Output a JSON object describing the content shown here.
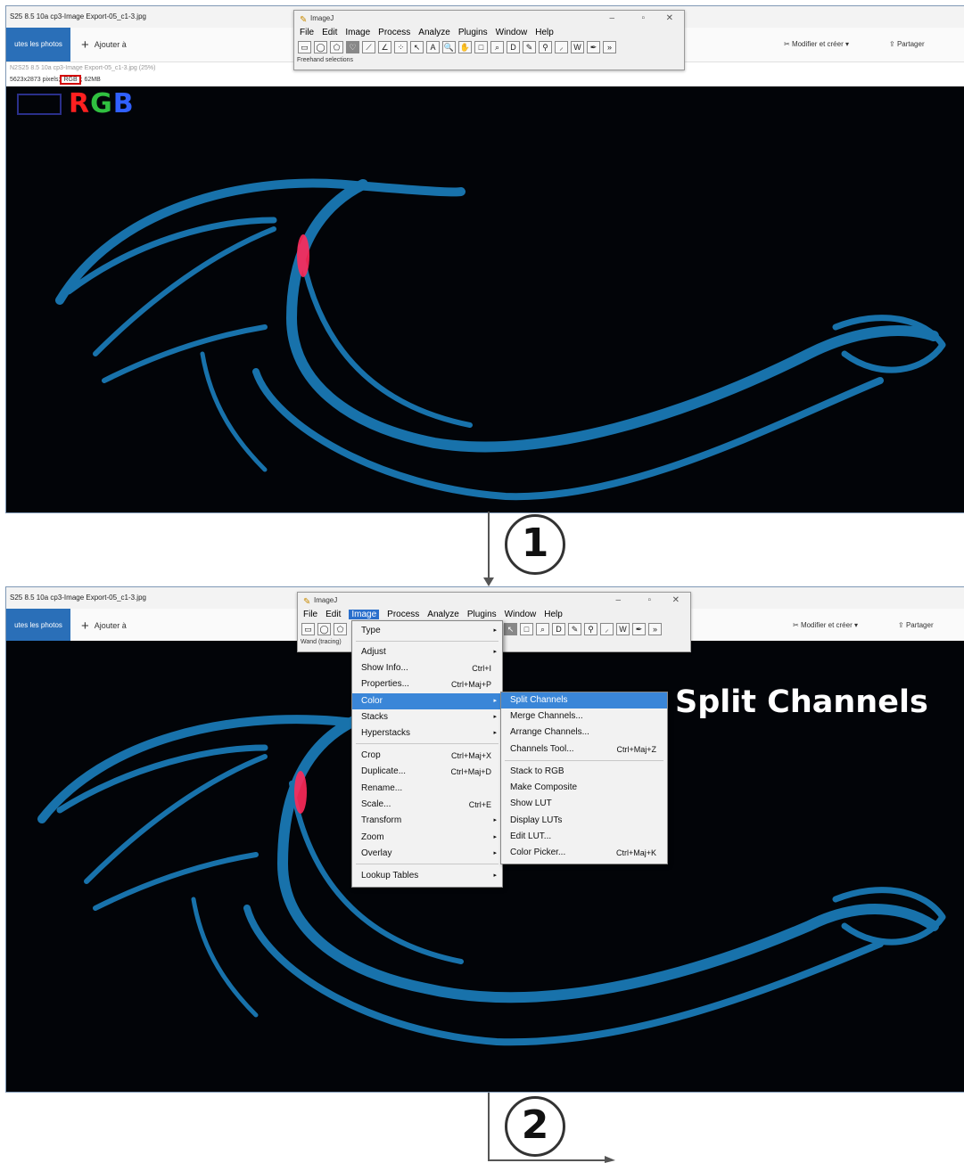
{
  "panel1": {
    "title": "S25 8.5 10a cp3-Image Export-05_c1-3.jpg",
    "photos_tab": "utes les photos",
    "add_label": "Ajouter à",
    "edit_create_label": "Modifier et créer",
    "share_label": "Partager",
    "subtitle": "N2S25 8.5 10a cp3-Image Export-05_c1-3.jpg (25%)",
    "info_prefix": "5623x2873 pixels;",
    "info_rgb": "RGB",
    "info_suffix": "; 62MB",
    "overlay_label": "RGB"
  },
  "imagej1": {
    "title": "ImageJ",
    "menus": [
      "File",
      "Edit",
      "Image",
      "Process",
      "Analyze",
      "Plugins",
      "Window",
      "Help"
    ],
    "status": "Freehand selections"
  },
  "panel2": {
    "title": "S25 8.5 10a cp3-Image Export-05_c1-3.jpg",
    "photos_tab": "utes les photos",
    "add_label": "Ajouter à",
    "edit_create_label": "Modifier et créer",
    "share_label": "Partager"
  },
  "imagej2": {
    "title": "ImageJ",
    "menus": [
      "File",
      "Edit",
      "Image",
      "Process",
      "Analyze",
      "Plugins",
      "Window",
      "Help"
    ],
    "status": "Wand (tracing)"
  },
  "image_menu": [
    {
      "label": "Type",
      "shortcut": "",
      "submenu": true
    },
    {
      "label": "Adjust",
      "shortcut": "",
      "submenu": true
    },
    {
      "label": "Show Info...",
      "shortcut": "Ctrl+I",
      "submenu": false
    },
    {
      "label": "Properties...",
      "shortcut": "Ctrl+Maj+P",
      "submenu": false
    },
    {
      "label": "Color",
      "shortcut": "",
      "submenu": true,
      "selected": true
    },
    {
      "label": "Stacks",
      "shortcut": "",
      "submenu": true
    },
    {
      "label": "Hyperstacks",
      "shortcut": "",
      "submenu": true
    },
    {
      "label": "Crop",
      "shortcut": "Ctrl+Maj+X",
      "submenu": false
    },
    {
      "label": "Duplicate...",
      "shortcut": "Ctrl+Maj+D",
      "submenu": false
    },
    {
      "label": "Rename...",
      "shortcut": "",
      "submenu": false
    },
    {
      "label": "Scale...",
      "shortcut": "Ctrl+E",
      "submenu": false
    },
    {
      "label": "Transform",
      "shortcut": "",
      "submenu": true
    },
    {
      "label": "Zoom",
      "shortcut": "",
      "submenu": true
    },
    {
      "label": "Overlay",
      "shortcut": "",
      "submenu": true
    },
    {
      "label": "Lookup Tables",
      "shortcut": "",
      "submenu": true
    }
  ],
  "color_submenu": [
    {
      "label": "Split Channels",
      "shortcut": "",
      "selected": true
    },
    {
      "label": "Merge Channels...",
      "shortcut": ""
    },
    {
      "label": "Arrange Channels...",
      "shortcut": ""
    },
    {
      "label": "Channels Tool...",
      "shortcut": "Ctrl+Maj+Z"
    },
    {
      "label": "Stack to RGB",
      "shortcut": ""
    },
    {
      "label": "Make Composite",
      "shortcut": ""
    },
    {
      "label": "Show LUT",
      "shortcut": ""
    },
    {
      "label": "Display LUTs",
      "shortcut": ""
    },
    {
      "label": "Edit LUT...",
      "shortcut": ""
    },
    {
      "label": "Color Picker...",
      "shortcut": "Ctrl+Maj+K"
    }
  ],
  "annotation": "Split Channels",
  "steps": [
    "1",
    "2"
  ],
  "colors": {
    "accent": "#3a86d8",
    "tissue": "#2aa6e8",
    "red_signal": "#ff2040",
    "background": "#020408"
  }
}
